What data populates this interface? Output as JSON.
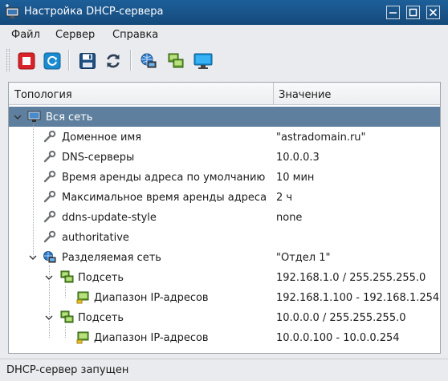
{
  "window": {
    "title": "Настройка DHCP-сервера"
  },
  "menu": {
    "file": "Файл",
    "server": "Сервер",
    "help": "Справка"
  },
  "toolbar": {
    "buttons": [
      "stop-icon",
      "restart-icon",
      "save-icon",
      "refresh-icon",
      "globe-network-icon",
      "subnet-icon",
      "monitor-icon"
    ]
  },
  "tree": {
    "columns": {
      "topology": "Топология",
      "value": "Значение"
    },
    "rows": [
      {
        "name": "Вся сеть",
        "value": "",
        "icon": "network-icon"
      },
      {
        "name": "Доменное имя",
        "value": "\"astradomain.ru\"",
        "icon": "wrench-icon"
      },
      {
        "name": "DNS-серверы",
        "value": "10.0.0.3",
        "icon": "wrench-icon"
      },
      {
        "name": "Время аренды адреса по умолчанию",
        "value": "10 мин",
        "icon": "wrench-icon"
      },
      {
        "name": "Максимальное время аренды адреса",
        "value": "2 ч",
        "icon": "wrench-icon"
      },
      {
        "name": "ddns-update-style",
        "value": "none",
        "icon": "wrench-icon"
      },
      {
        "name": "authoritative",
        "value": "",
        "icon": "wrench-icon"
      },
      {
        "name": "Разделяемая сеть",
        "value": "\"Отдел 1\"",
        "icon": "shared-network-icon"
      },
      {
        "name": "Подсеть",
        "value": "192.168.1.0 / 255.255.255.0",
        "icon": "subnet-icon"
      },
      {
        "name": "Диапазон IP-адресов",
        "value": "192.168.1.100 - 192.168.1.254",
        "icon": "range-icon"
      },
      {
        "name": "Подсеть",
        "value": "10.0.0.0 / 255.255.255.0",
        "icon": "subnet-icon"
      },
      {
        "name": "Диапазон IP-адресов",
        "value": "10.0.0.100 - 10.0.0.254",
        "icon": "range-icon"
      }
    ]
  },
  "status": {
    "text": "DHCP-сервер запущен"
  },
  "colors": {
    "titlebar": "#1d5f99",
    "selection": "#5e7f9e",
    "stop": "#d8232a",
    "accent": "#1a8bd0"
  }
}
